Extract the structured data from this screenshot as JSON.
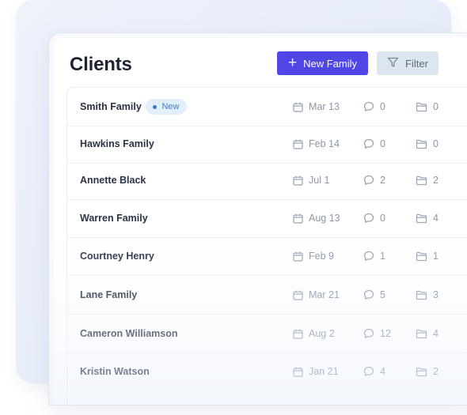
{
  "page": {
    "title": "Clients"
  },
  "toolbar": {
    "new_label": "New Family",
    "filter_label": "Filter"
  },
  "colors": {
    "accent": "#4f46e5",
    "badge_bg": "#e1effc",
    "badge_text": "#3c7fc9"
  },
  "clients": [
    {
      "name": "Smith Family",
      "badge": "New",
      "date": "Mar 13",
      "comments": "0",
      "files": "0"
    },
    {
      "name": "Hawkins Family",
      "date": "Feb 14",
      "comments": "0",
      "files": "0"
    },
    {
      "name": "Annette Black",
      "date": "Jul 1",
      "comments": "2",
      "files": "2"
    },
    {
      "name": "Warren Family",
      "date": "Aug 13",
      "comments": "0",
      "files": "4"
    },
    {
      "name": "Courtney Henry",
      "date": "Feb 9",
      "comments": "1",
      "files": "1"
    },
    {
      "name": "Lane Family",
      "date": "Mar 21",
      "comments": "5",
      "files": "3"
    },
    {
      "name": "Cameron Williamson",
      "date": "Aug 2",
      "comments": "12",
      "files": "4"
    },
    {
      "name": "Kristin Watson",
      "date": "Jan 21",
      "comments": "4",
      "files": "2"
    }
  ],
  "icons": {
    "new": "plus-icon",
    "filter": "filter-icon",
    "date": "calendar-icon",
    "comments": "comment-icon",
    "files": "folder-icon"
  }
}
